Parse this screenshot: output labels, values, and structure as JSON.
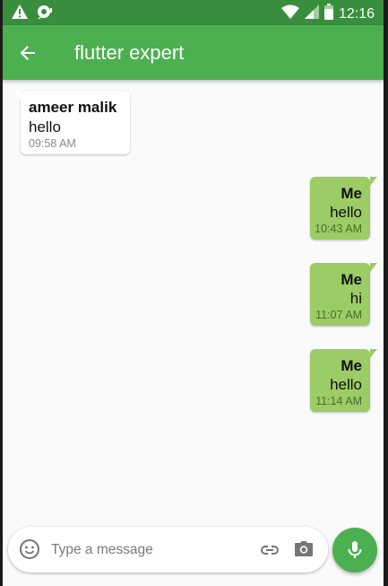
{
  "status_bar": {
    "time": "12:16"
  },
  "app_bar": {
    "title": "flutter expert"
  },
  "messages": [
    {
      "sender": "ameer malik",
      "text": "hello",
      "time": "09:58 AM",
      "direction": "incoming"
    },
    {
      "sender": "Me",
      "text": "hello",
      "time": "10:43 AM",
      "direction": "outgoing"
    },
    {
      "sender": "Me",
      "text": "hi",
      "time": "11:07 AM",
      "direction": "outgoing"
    },
    {
      "sender": "Me",
      "text": "hello",
      "time": "11:14 AM",
      "direction": "outgoing"
    }
  ],
  "composer": {
    "placeholder": "Type a message",
    "value": ""
  },
  "icons": {
    "status": [
      "warning-icon",
      "notification-icon",
      "wifi-icon",
      "signal-icon",
      "battery-icon"
    ],
    "back": "arrow-back-icon",
    "emoji": "emoji-icon",
    "attach": "link-icon",
    "camera": "camera-icon",
    "mic": "mic-icon"
  },
  "colors": {
    "status_bar": "#388e3c",
    "app_bar": "#4caf50",
    "outgoing_bubble": "#9ccc65",
    "incoming_bubble": "#ffffff",
    "mic_button": "#4caf50"
  }
}
